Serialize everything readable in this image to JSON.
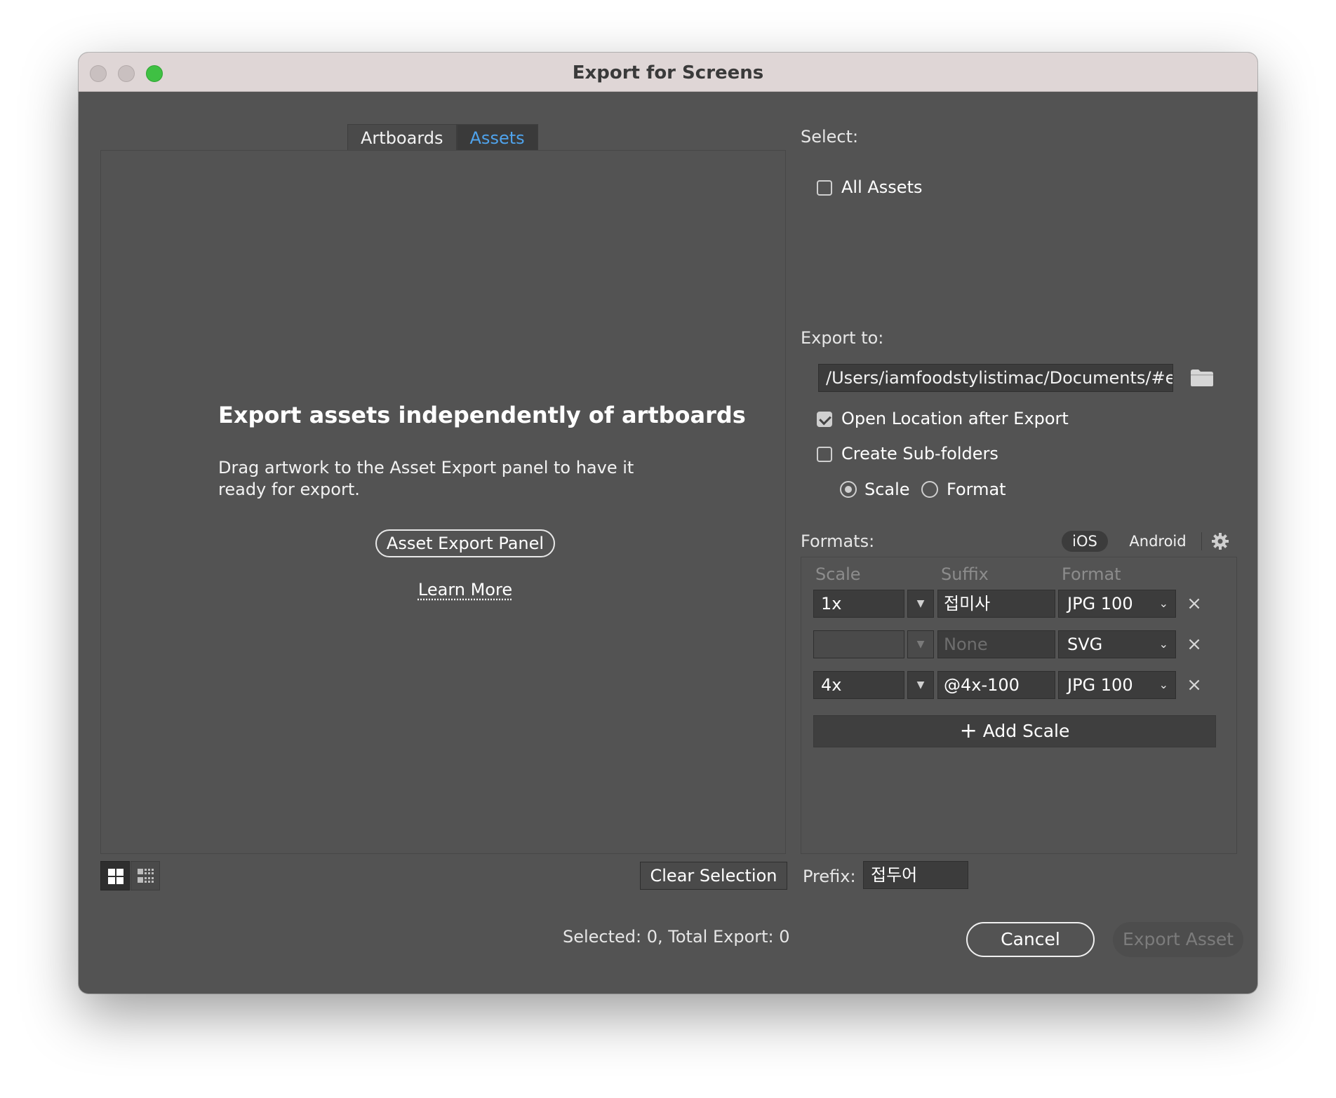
{
  "window": {
    "title": "Export for Screens"
  },
  "tabs": [
    {
      "label": "Artboards",
      "active": false
    },
    {
      "label": "Assets",
      "active": true
    }
  ],
  "empty_state": {
    "title": "Export assets independently of artboards",
    "description": "Drag artwork to the Asset Export panel to have it ready for export.",
    "panel_button": "Asset Export Panel",
    "learn_more": "Learn More"
  },
  "select": {
    "label": "Select:",
    "all_assets": {
      "label": "All Assets",
      "checked": false
    }
  },
  "export_to": {
    "label": "Export to:",
    "path": "/Users/iamfoodstylistimac/Documents/#ex",
    "open_location": {
      "label": "Open Location after Export",
      "checked": true
    },
    "sub_folders": {
      "label": "Create Sub-folders",
      "checked": false
    },
    "subfolder_mode": [
      {
        "label": "Scale",
        "selected": true
      },
      {
        "label": "Format",
        "selected": false
      }
    ]
  },
  "formats": {
    "label": "Formats:",
    "presets": [
      "iOS",
      "Android"
    ],
    "columns": [
      "Scale",
      "Suffix",
      "Format"
    ],
    "rows": [
      {
        "scale": "1x",
        "suffix": "접미사",
        "suffix_placeholder": "",
        "format": "JPG 100",
        "scale_enabled": true
      },
      {
        "scale": "",
        "suffix": "",
        "suffix_placeholder": "None",
        "format": "SVG",
        "scale_enabled": false
      },
      {
        "scale": "4x",
        "suffix": "@4x-100",
        "suffix_placeholder": "",
        "format": "JPG 100",
        "scale_enabled": true
      }
    ],
    "add_scale": "Add Scale"
  },
  "bottom": {
    "clear_selection": "Clear Selection",
    "prefix_label": "Prefix:",
    "prefix_value": "접두어",
    "status": "Selected: 0, Total Export: 0",
    "cancel": "Cancel",
    "export": "Export Asset"
  },
  "colors": {
    "window_bg": "#535353",
    "titlebar_bg": "#dfd6d6",
    "active_tab_text": "#4fa3ec",
    "maximize_green": "#3fc043"
  },
  "icons": [
    "folder-icon",
    "gear-icon",
    "close-icon",
    "plus-icon",
    "grid-view-icon",
    "list-view-icon",
    "chevron-down-icon"
  ]
}
